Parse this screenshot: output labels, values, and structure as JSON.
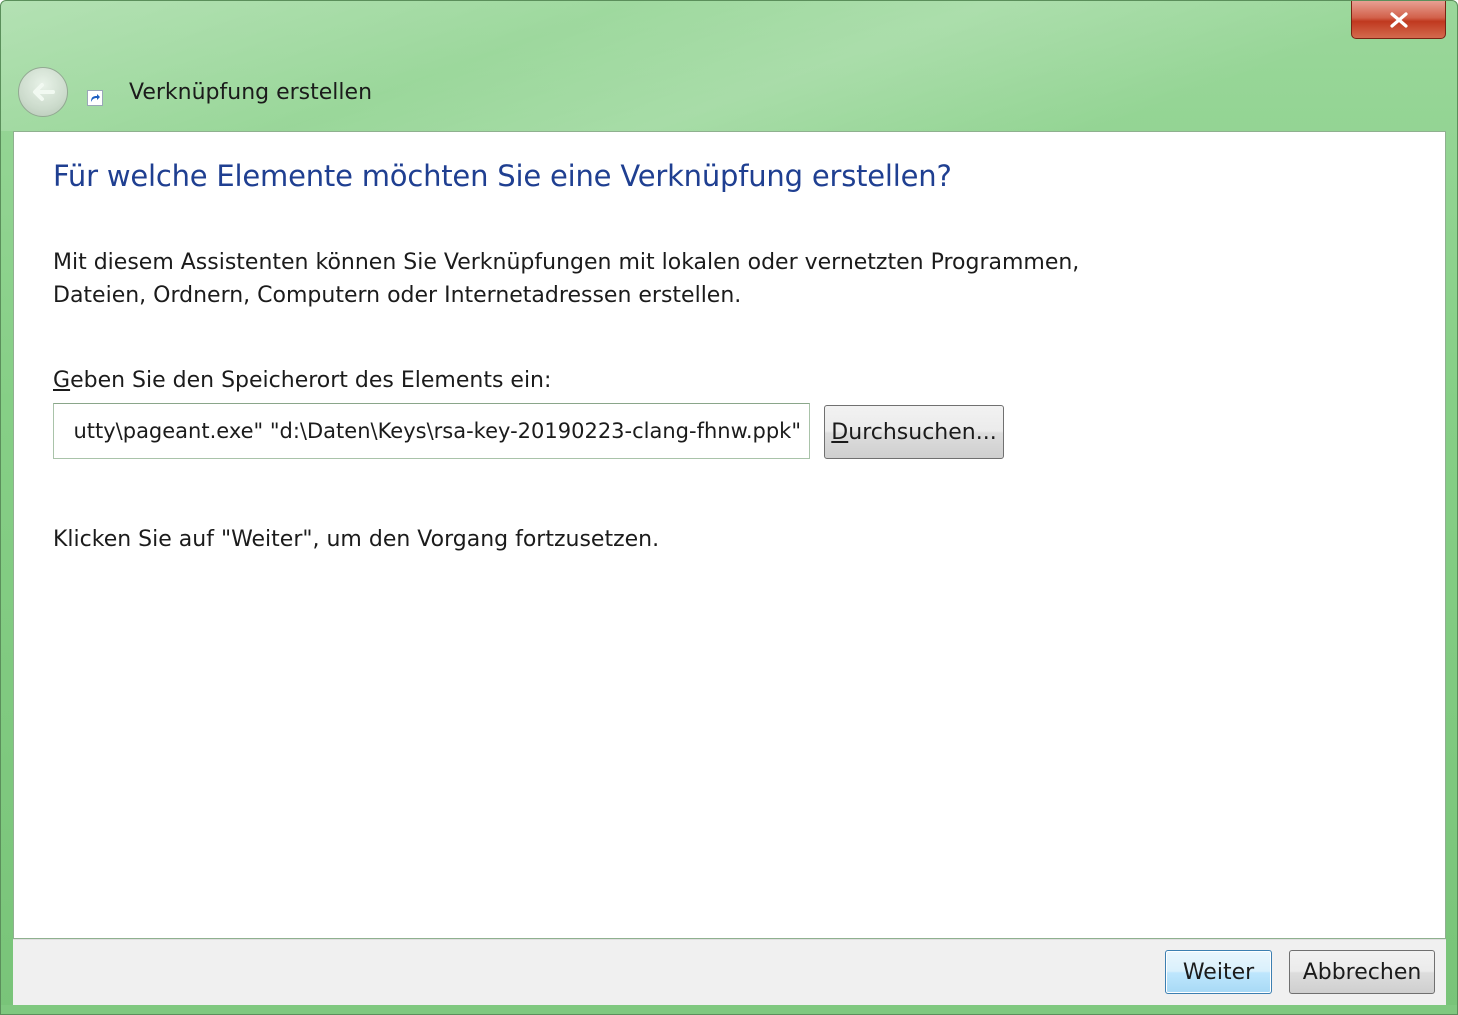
{
  "window": {
    "title": "Verknüpfung erstellen",
    "close_label": "✕"
  },
  "icons": {
    "back": "back-arrow-icon",
    "shortcut": "shortcut-icon",
    "close": "close-icon"
  },
  "main": {
    "heading": "Für welche Elemente möchten Sie eine Verknüpfung erstellen?",
    "description": "Mit diesem Assistenten können Sie Verknüpfungen mit lokalen oder vernetzten Programmen, Dateien, Ordnern, Computern oder Internetadressen erstellen.",
    "location_label_mnemonic": "G",
    "location_label_rest": "eben Sie den Speicherort des Elements ein:",
    "location_value": "utty\\pageant.exe\" \"d:\\Daten\\Keys\\rsa-key-20190223-clang-fhnw.ppk\"",
    "browse_mnemonic": "D",
    "browse_rest": "urchsuchen...",
    "hint": "Klicken Sie auf \"Weiter\", um den Vorgang fortzusetzen."
  },
  "footer": {
    "next_label": "Weiter",
    "cancel_label": "Abbrechen"
  },
  "colors": {
    "frame": "#86cf86",
    "heading": "#1f3f91",
    "close": "#c0391f",
    "default_button_border": "#3c7fb1"
  }
}
